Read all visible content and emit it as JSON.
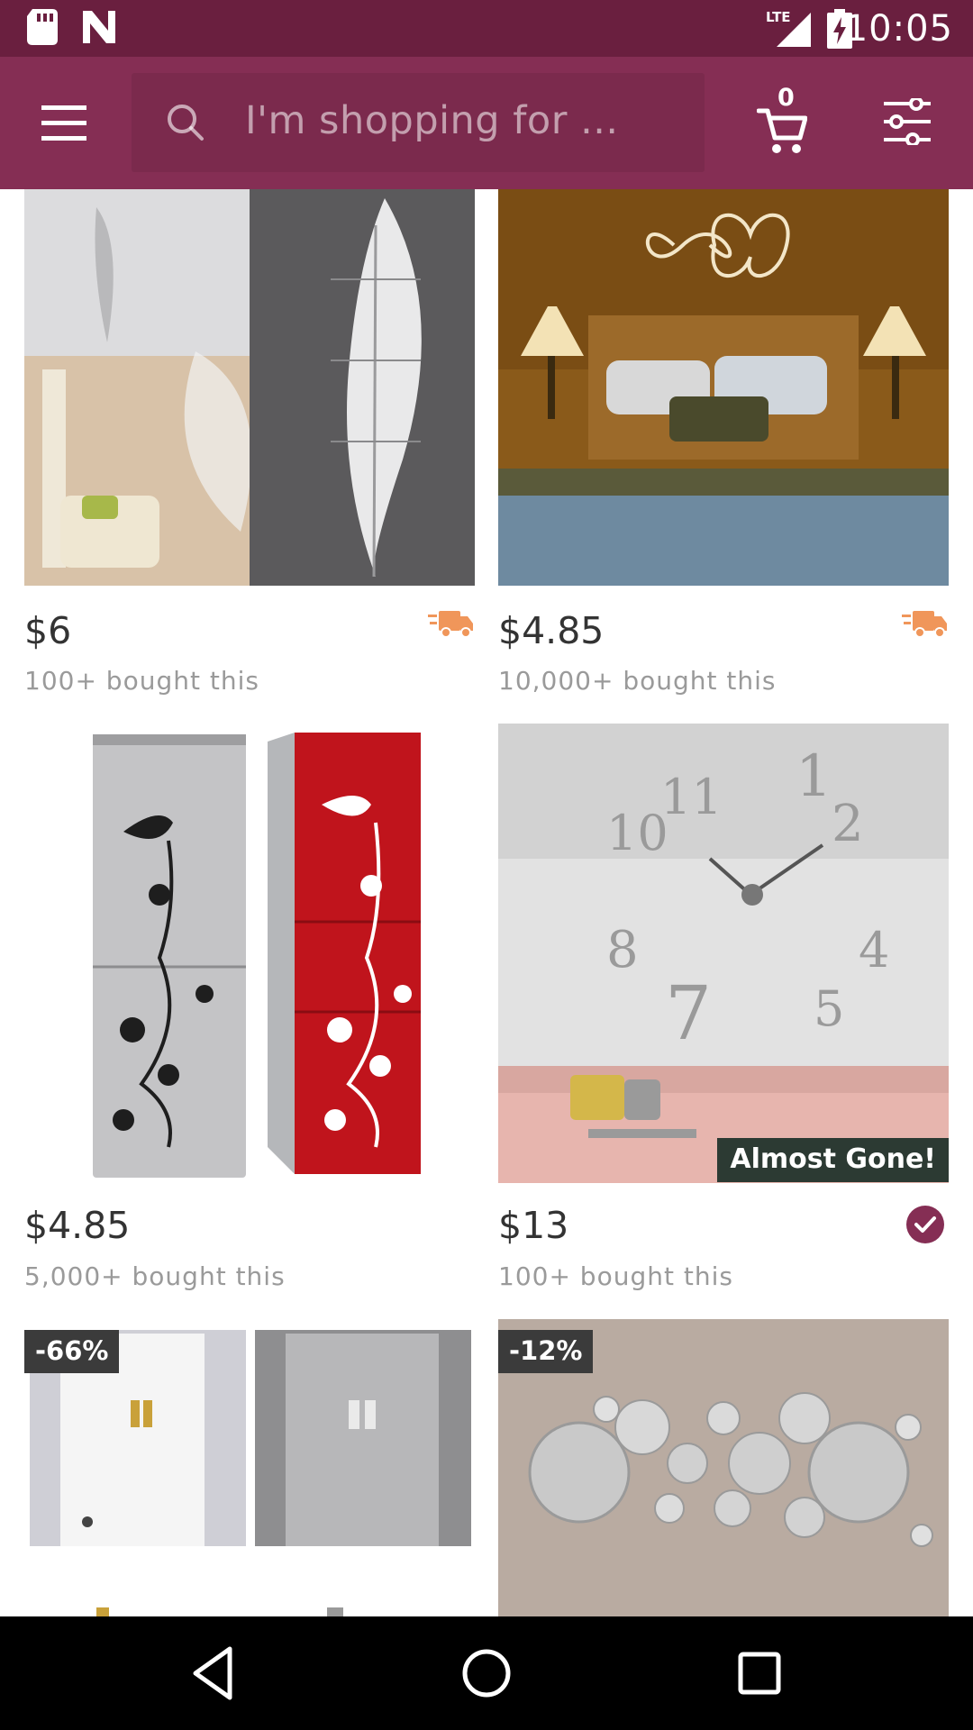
{
  "status_bar": {
    "time": "10:05",
    "network": "LTE",
    "icons": [
      "sd-card-icon",
      "n-notification-icon",
      "signal-icon",
      "battery-charging-icon"
    ]
  },
  "app_bar": {
    "background_color": "#852e54",
    "menu_icon": "hamburger-menu-icon",
    "search": {
      "placeholder": "I'm shopping for ...",
      "icon": "search-icon"
    },
    "cart": {
      "count": "0",
      "icon": "shopping-cart-icon"
    },
    "filter_icon": "filter-sliders-icon"
  },
  "products": [
    {
      "price": "$6",
      "bought": "100+ bought this",
      "badge_icon": "fast-shipping-truck-icon",
      "image": "feather mirror wall sticker"
    },
    {
      "price": "$4.85",
      "bought": "10,000+ bought this",
      "badge_icon": "fast-shipping-truck-icon",
      "image": "infinity love bedroom wall decal"
    },
    {
      "price": "$4.85",
      "bought": "5,000+ bought this",
      "image": "butterfly flower fridge sticker"
    },
    {
      "price": "$13",
      "bought": "100+ bought this",
      "badge_icon": "verified-check-icon",
      "overlay_label": "Almost Gone!",
      "image": "3D mirror wall clock"
    },
    {
      "discount": "-66%",
      "image": "door number stickers"
    },
    {
      "discount": "-12%",
      "image": "round mirror wall stickers"
    }
  ],
  "nav_bar": {
    "buttons": [
      "back-icon",
      "home-icon",
      "recents-icon"
    ]
  },
  "colors": {
    "status_bar": "#6a1f3f",
    "app_bar": "#852e54",
    "search_box": "#7b2a4d",
    "truck": "#f0965a",
    "check": "#852e54",
    "badge_dark": "#2c3a33"
  }
}
